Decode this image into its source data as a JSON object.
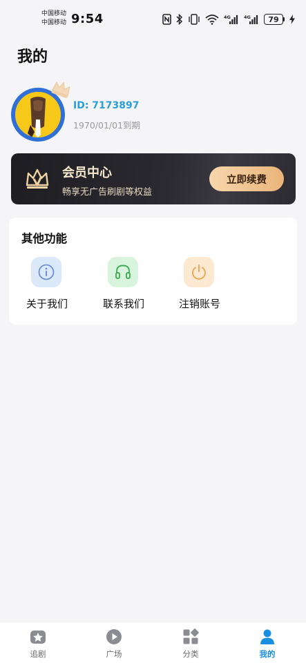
{
  "status_bar": {
    "carrier_1": "中国移动",
    "carrier_2": "中国移动",
    "time": "9:54",
    "battery": "79",
    "network_1": "4G",
    "network_2": "4G"
  },
  "page": {
    "title": "我的"
  },
  "profile": {
    "id_text": "ID: 7173897",
    "expire_text": "1970/01/01到期"
  },
  "vip": {
    "title": "会员中心",
    "subtitle": "畅享无广告刷剧等权益",
    "button_label": "立即续费",
    "colors": {
      "button_start": "#f6d7ac",
      "button_end": "#eab47a",
      "card_bg": "#1d1d22"
    }
  },
  "functions": {
    "title": "其他功能",
    "items": [
      {
        "label": "关于我们",
        "icon": "info-icon",
        "color": "#dce9fb"
      },
      {
        "label": "联系我们",
        "icon": "headset-icon",
        "color": "#d9f4dd"
      },
      {
        "label": "注销账号",
        "icon": "power-icon",
        "color": "#fde9d2"
      }
    ]
  },
  "bottom_nav": {
    "active_color": "#1a8ee0",
    "items": [
      {
        "label": "追剧",
        "icon": "star-icon"
      },
      {
        "label": "广场",
        "icon": "play-icon"
      },
      {
        "label": "分类",
        "icon": "category-icon"
      },
      {
        "label": "我的",
        "icon": "user-icon",
        "active": true
      }
    ]
  }
}
